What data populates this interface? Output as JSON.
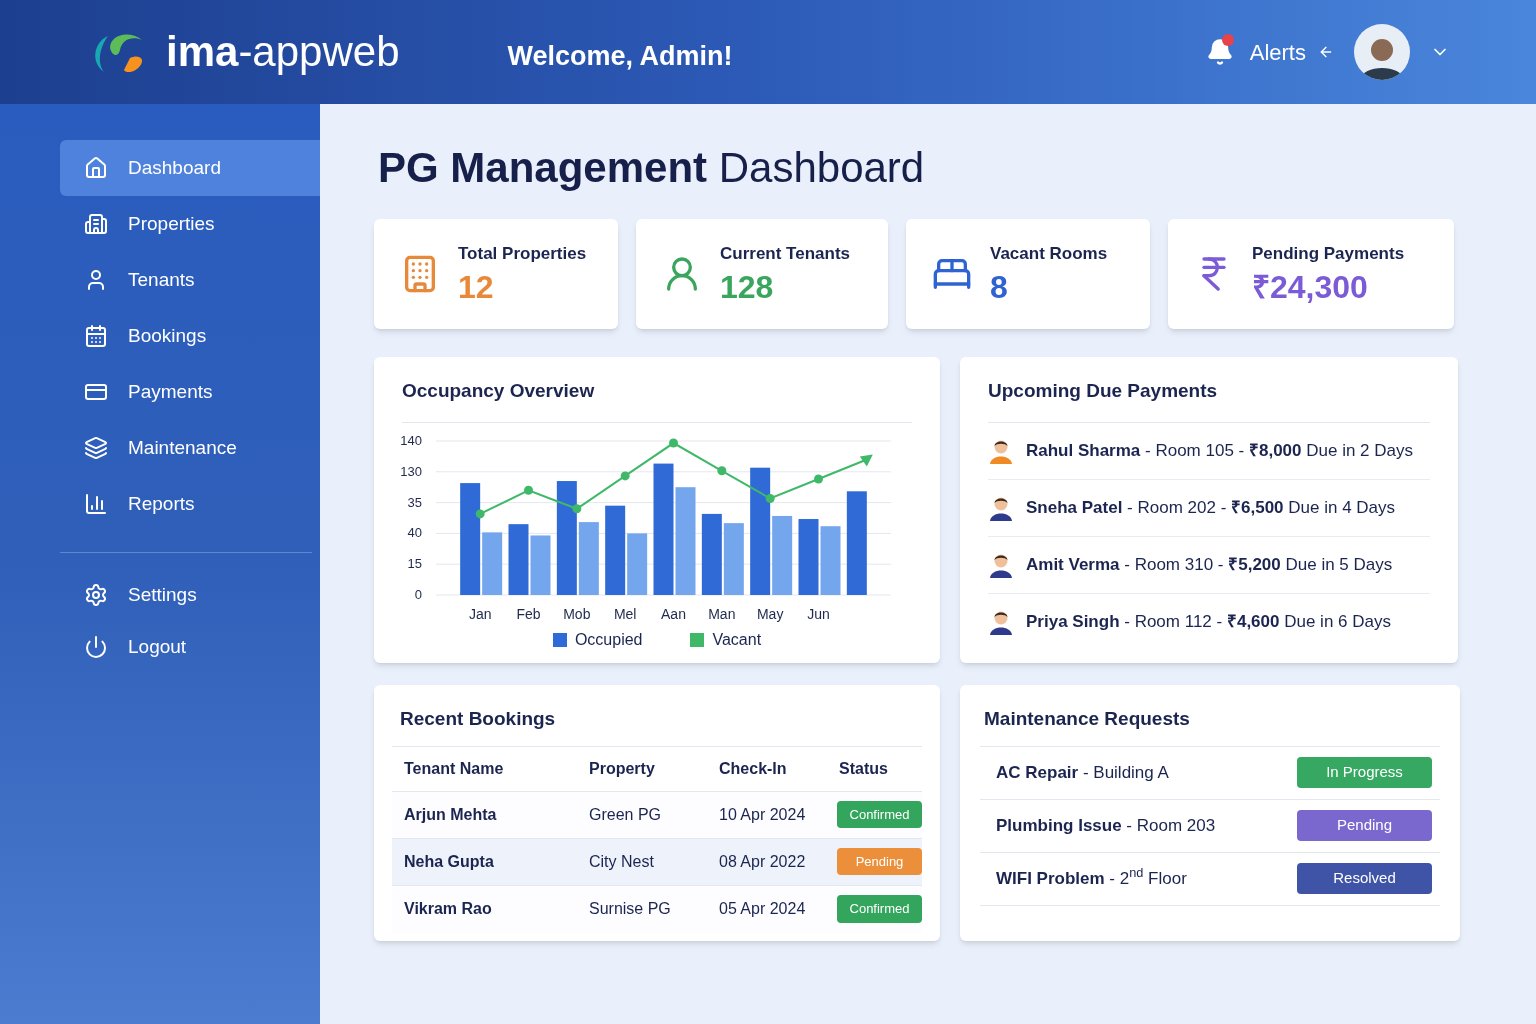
{
  "header": {
    "brand_bold": "ima",
    "brand_rest": "-appweb",
    "welcome": "Welcome, Admin!",
    "alerts": "Alerts",
    "alerts_unread": true
  },
  "sidebar": {
    "items": [
      {
        "label": "Dashboard",
        "selected": true
      },
      {
        "label": "Properties",
        "selected": false
      },
      {
        "label": "Tenants",
        "selected": false
      },
      {
        "label": "Bookings",
        "selected": false
      },
      {
        "label": "Payments",
        "selected": false
      },
      {
        "label": "Maintenance",
        "selected": false
      },
      {
        "label": "Reports",
        "selected": false
      }
    ],
    "footer_items": [
      {
        "label": "Settings"
      },
      {
        "label": "Logout"
      }
    ]
  },
  "page_title_bold": "PG Management",
  "page_title_rest": "Dashboard",
  "stats": [
    {
      "label": "Total Properties",
      "value": "12",
      "color": "#e8893a"
    },
    {
      "label": "Current Tenants",
      "value": "128",
      "color": "#3aa55c"
    },
    {
      "label": "Vacant Rooms",
      "value": "8",
      "color": "#2f63d1"
    },
    {
      "label": "Pending Payments",
      "value": "₹24,300",
      "color": "#7b5cd6"
    }
  ],
  "occupancy": {
    "title": "Occupancy Overview",
    "y_axis_labels": [
      "140",
      "130",
      "35",
      "40",
      "15",
      "0"
    ],
    "x_axis_labels": [
      "Jan",
      "Feb",
      "Mob",
      "Mel",
      "Aan",
      "Man",
      "May",
      "Jun"
    ],
    "legend": [
      {
        "label": "Occupied",
        "color": "#2f6ad6"
      },
      {
        "label": "Vacant",
        "color": "#3fb86a"
      }
    ]
  },
  "due_payments": {
    "title": "Upcoming Due Payments",
    "items": [
      {
        "text": "**Rahul Sharma** - Room 105 - **₹8,000** Due in 2 Days"
      },
      {
        "text": "**Sneha Patel** - Room 202 - **₹6,500** Due in 4 Days"
      },
      {
        "text": "**Amit Verma** - Room 310 - **₹5,200** Due in 5 Days"
      },
      {
        "text": "**Priya Singh** - Room 112 - **₹4,600** Due in 6 Days"
      }
    ]
  },
  "recent_bookings": {
    "title": "Recent Bookings",
    "columns": [
      "Tenant Name",
      "Property",
      "Check-In",
      "Status"
    ],
    "rows": [
      {
        "tenant": "Arjun Mehta",
        "property": "Green PG",
        "check_in": "10 Apr 2024",
        "status": "Confirmed",
        "color": "#33a55c",
        "highlighted": false
      },
      {
        "tenant": "Neha Gupta",
        "property": "City Nest",
        "check_in": "08 Apr 2022",
        "status": "Pending",
        "color": "#ec8f3a",
        "highlighted": true
      },
      {
        "tenant": "Vikram Rao",
        "property": "Surnise PG",
        "check_in": "05 Apr 2024",
        "status": "Confirmed",
        "color": "#33a55c",
        "highlighted": false
      }
    ]
  },
  "maintenance": {
    "title": "Maintenance Requests",
    "items": [
      {
        "text": "**AC Repair** - Building A",
        "status": "In Progress",
        "color": "#36a862"
      },
      {
        "text": "**Plumbing Issue** - Room 203",
        "status": "Pending",
        "color": "#7a68cf"
      },
      {
        "text": "**WIFI Problem** - 2$^{nd}$ Floor",
        "status": "Resolved",
        "color": "#3f54a6"
      }
    ]
  }
}
